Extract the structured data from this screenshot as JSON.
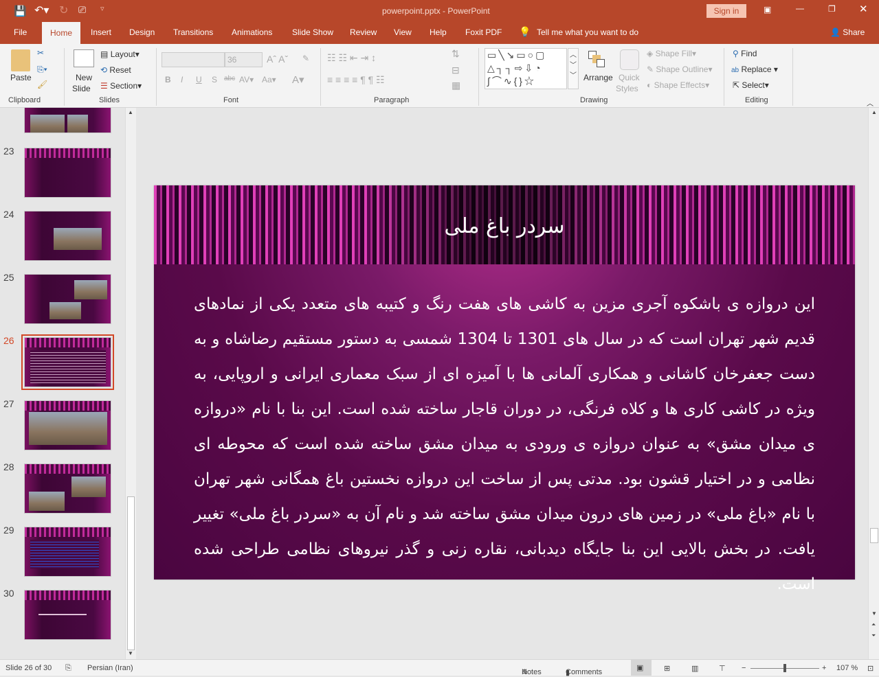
{
  "titlebar": {
    "title": "powerpoint.pptx  -  PowerPoint",
    "sign_in": "Sign in"
  },
  "tabs": [
    "File",
    "Home",
    "Insert",
    "Design",
    "Transitions",
    "Animations",
    "Slide Show",
    "Review",
    "View",
    "Help",
    "Foxit PDF"
  ],
  "tell_me": "Tell me what you want to do",
  "share": "Share",
  "ribbon": {
    "clipboard": {
      "paste": "Paste",
      "label": "Clipboard"
    },
    "slides": {
      "new_slide": "New",
      "new_slide2": "Slide",
      "layout": "Layout",
      "reset": "Reset",
      "section": "Section",
      "label": "Slides"
    },
    "font": {
      "size": "36",
      "label": "Font"
    },
    "paragraph": {
      "label": "Paragraph"
    },
    "drawing": {
      "arrange": "Arrange",
      "quick": "Quick",
      "styles": "Styles",
      "fill": "Shape Fill",
      "outline": "Shape Outline",
      "effects": "Shape Effects",
      "label": "Drawing"
    },
    "editing": {
      "find": "Find",
      "replace": "Replace",
      "select": "Select",
      "label": "Editing"
    }
  },
  "thumbnails": [
    {
      "n": "23"
    },
    {
      "n": "24"
    },
    {
      "n": "25"
    },
    {
      "n": "26",
      "selected": true
    },
    {
      "n": "27"
    },
    {
      "n": "28"
    },
    {
      "n": "29"
    },
    {
      "n": "30"
    }
  ],
  "slide": {
    "title": "سردر باغ ملی",
    "body": "این دروازه ی باشکوه آجری مزین به کاشی های هفت رنگ و کتیبه های متعدد یکی از نمادهای قدیم شهر تهران است که در سال های 1301 تا 1304 شمسی به دستور مستقیم رضاشاه و به دست جعفرخان کاشانی و همکاری آلمانی ها با آمیزه ای از سبک معماری ایرانی و اروپایی، به ویژه در کاشی کاری ها و کلاه فرنگی، در دوران قاجار ساخته شده است. این بنا با نام «دروازه ی میدان مشق» به عنوان دروازه ی ورودی به میدان مشق ساخته شده است که محوطه ای نظامی و در اختیار قشون بود. مدتی پس از ساخت این دروازه نخستین باغ همگانی شهر تهران با نام «باغ ملی» در زمین های درون میدان مشق ساخته شد و نام آن به «سردر باغ ملی» تغییر یافت. در بخش بالایی این بنا جایگاه دیدبانی، نقاره زنی و گذر نیروهای نظامی طراحی شده است."
  },
  "status": {
    "slide": "Slide 26 of 30",
    "language": "Persian (Iran)",
    "notes": "Notes",
    "comments": "Comments",
    "zoom": "107 %",
    "zoom_level": 107
  },
  "colors": {
    "accent": "#b7472a"
  }
}
